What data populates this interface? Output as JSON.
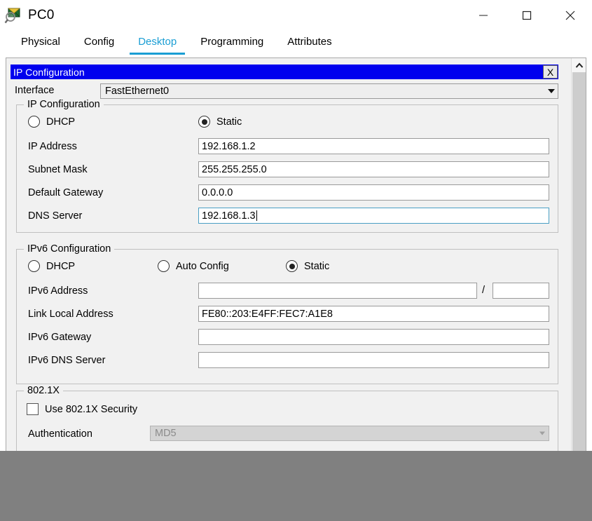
{
  "window": {
    "title": "PC0",
    "icon": "packet-tracer-icon",
    "controls": {
      "minimize": "minimize-icon",
      "maximize": "maximize-icon",
      "close": "close-icon"
    }
  },
  "tabs": [
    {
      "label": "Physical",
      "active": false
    },
    {
      "label": "Config",
      "active": false
    },
    {
      "label": "Desktop",
      "active": true
    },
    {
      "label": "Programming",
      "active": false
    },
    {
      "label": "Attributes",
      "active": false
    }
  ],
  "panel": {
    "title": "IP Configuration",
    "close_label": "X"
  },
  "interface": {
    "label": "Interface",
    "value": "FastEthernet0",
    "arrow": "chevron-down-icon"
  },
  "ipv4": {
    "legend": "IP Configuration",
    "dhcp_label": "DHCP",
    "dhcp_selected": false,
    "static_label": "Static",
    "static_selected": true,
    "fields": [
      {
        "label": "IP Address",
        "value": "192.168.1.2",
        "focused": false
      },
      {
        "label": "Subnet Mask",
        "value": "255.255.255.0",
        "focused": false
      },
      {
        "label": "Default Gateway",
        "value": "0.0.0.0",
        "focused": false
      },
      {
        "label": "DNS Server",
        "value": "192.168.1.3",
        "focused": true
      }
    ]
  },
  "ipv6": {
    "legend": "IPv6 Configuration",
    "dhcp_label": "DHCP",
    "dhcp_selected": false,
    "auto_label": "Auto Config",
    "auto_selected": false,
    "static_label": "Static",
    "static_selected": true,
    "address_label": "IPv6 Address",
    "address_value": "",
    "prefix_separator": "/",
    "prefix_value": "",
    "link_local_label": "Link Local Address",
    "link_local_value": "FE80::203:E4FF:FEC7:A1E8",
    "gateway_label": "IPv6 Gateway",
    "gateway_value": "",
    "dns_label": "IPv6 DNS Server",
    "dns_value": ""
  },
  "dot1x": {
    "legend": "802.1X",
    "use_label": "Use 802.1X Security",
    "use_checked": false,
    "auth_label": "Authentication",
    "auth_value": "MD5"
  },
  "scrollbar": {
    "up_arrow": "chevron-up-icon"
  },
  "colors": {
    "accent": "#1a9ed4",
    "panel_title_bg": "#0000ee",
    "focus_border": "#4a9fc4",
    "overlay": "#808080"
  }
}
